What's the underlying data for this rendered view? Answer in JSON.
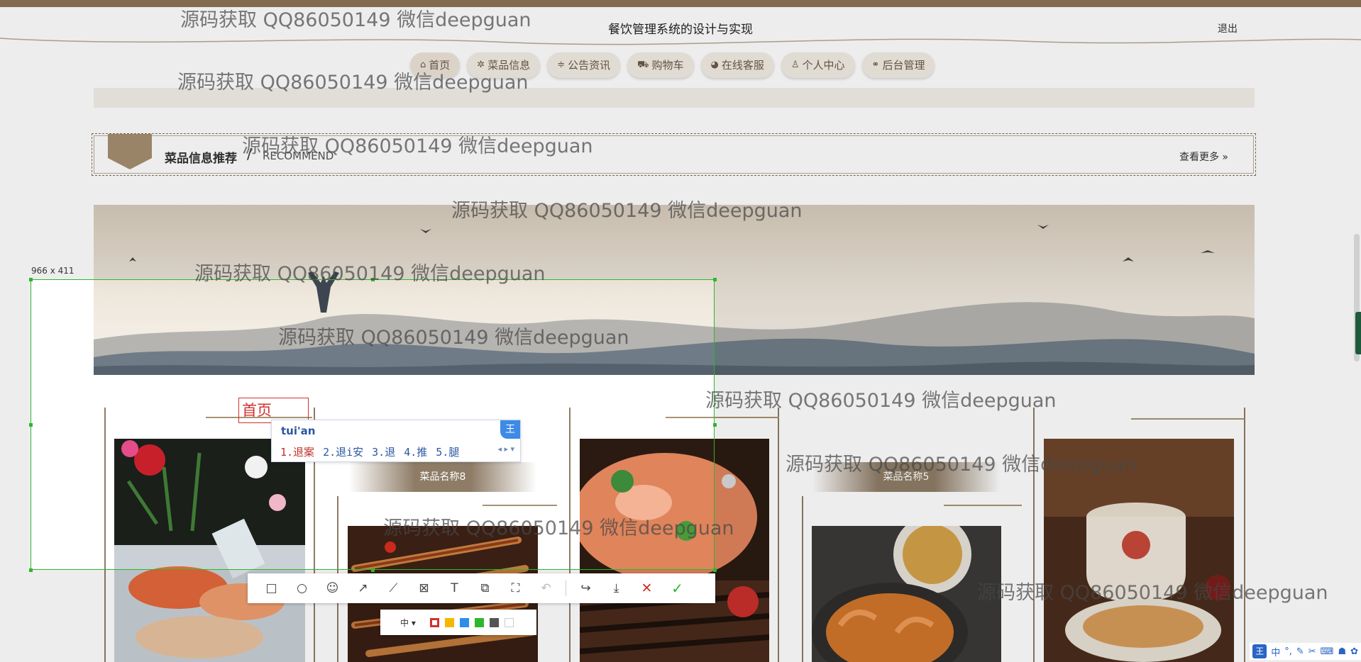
{
  "site": {
    "title": "餐饮管理系统的设计与实现",
    "logout": "退出"
  },
  "nav": [
    {
      "icon": "⌂",
      "label": "首页"
    },
    {
      "icon": "✲",
      "label": "菜品信息"
    },
    {
      "icon": "≑",
      "label": "公告资讯"
    },
    {
      "icon": "⛟",
      "label": "购物车"
    },
    {
      "icon": "◕",
      "label": "在线客服"
    },
    {
      "icon": "♙",
      "label": "个人中心"
    },
    {
      "icon": "⚭",
      "label": "后台管理"
    }
  ],
  "recommend": {
    "title": "菜品信息推荐",
    "slash": "/",
    "subtitle": "RECOMMEND",
    "more": "查看更多 »"
  },
  "products": {
    "name_a": "菜品名称8",
    "name_b": "菜品名称5"
  },
  "capture": {
    "size_label": "966 x 411",
    "text_input": "首页"
  },
  "ime": {
    "composition": "tui'an",
    "badge": "王",
    "candidates": [
      "1.退案",
      "2.退i安",
      "3.退",
      "4.推",
      "5.腿"
    ],
    "pager": "◂ ▸ ▾"
  },
  "toolbar": {
    "tools": [
      {
        "name": "rectangle-tool",
        "icon": "□"
      },
      {
        "name": "ellipse-tool",
        "icon": "○"
      },
      {
        "name": "emoji-tool",
        "icon": "☺"
      },
      {
        "name": "arrow-tool",
        "icon": "↗"
      },
      {
        "name": "line-tool",
        "icon": "⟋"
      },
      {
        "name": "mosaic-tool",
        "icon": "⊠"
      },
      {
        "name": "text-tool",
        "icon": "T"
      },
      {
        "name": "pin-tool",
        "icon": "⧉"
      },
      {
        "name": "ocr-tool",
        "icon": "⛶"
      },
      {
        "name": "undo-tool",
        "icon": "↶"
      }
    ],
    "actions": [
      {
        "name": "share-button",
        "icon": "↪"
      },
      {
        "name": "save-button",
        "icon": "⤓"
      },
      {
        "name": "cancel-button",
        "icon": "✕"
      },
      {
        "name": "confirm-button",
        "icon": "✓"
      }
    ]
  },
  "colorbar": {
    "size": "中 ▾",
    "colors": [
      "#d0312d",
      "#f5b800",
      "#2d8fe8",
      "#2fb62f",
      "#555555",
      "#ffffff"
    ]
  },
  "watermark": "源码获取 QQ86050149 微信deepguan",
  "taskbar": [
    "王",
    "中",
    "°,",
    "✎",
    "✂",
    "⌨",
    "☗",
    "✿"
  ]
}
